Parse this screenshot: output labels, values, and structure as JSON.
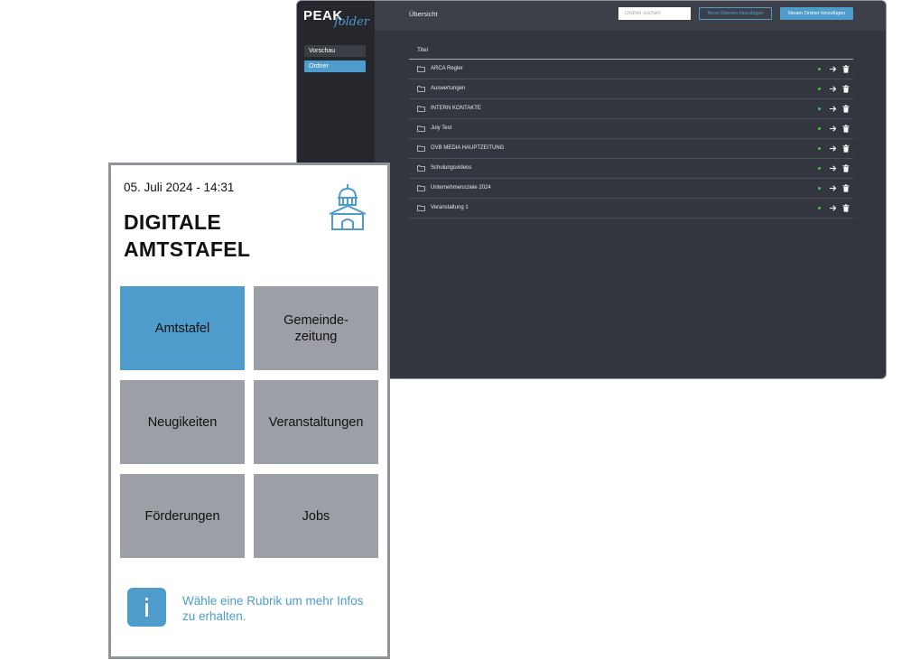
{
  "admin": {
    "logo_main": "PEAK",
    "logo_sub": "folder",
    "sidebar": [
      {
        "label": "Vorschau"
      },
      {
        "label": "Ordner"
      }
    ],
    "topbar": {
      "title": "Übersicht",
      "search_placeholder": "Ordner suchen",
      "add_files_label": "Neue Dateien hinzufügen",
      "add_folder_label": "Neuen Ordner hinzufügen"
    },
    "table": {
      "column_title": "Titel",
      "rows": [
        {
          "title": "ARCA Regler"
        },
        {
          "title": "Auswertungen"
        },
        {
          "title": "INTERN KONTAKTE"
        },
        {
          "title": "July Test"
        },
        {
          "title": "OVB MEDIA HAUPTZEITUNG"
        },
        {
          "title": "Schulungsvideos"
        },
        {
          "title": "Unternehmensziele 2024"
        },
        {
          "title": "Veranstaltung 1"
        }
      ]
    }
  },
  "kiosk": {
    "datetime": "05. Juli 2024 - 14:31",
    "title": "DIGITALE AMTSTAFEL",
    "tiles": [
      {
        "label": "Amtstafel",
        "active": true
      },
      {
        "label": "Gemeinde-zeitung"
      },
      {
        "label": "Neugikeiten"
      },
      {
        "label": "Veranstaltungen"
      },
      {
        "label": "Förderungen"
      },
      {
        "label": "Jobs"
      }
    ],
    "info_text": "Wähle eine Rubrik um mehr Infos zu erhalten."
  },
  "colors": {
    "accent": "#4e9ccc",
    "admin_bg": "#34363f",
    "sidebar_bg": "#25272c",
    "tile_gray": "#9d9fa6",
    "status_green": "#3ecf3e"
  }
}
